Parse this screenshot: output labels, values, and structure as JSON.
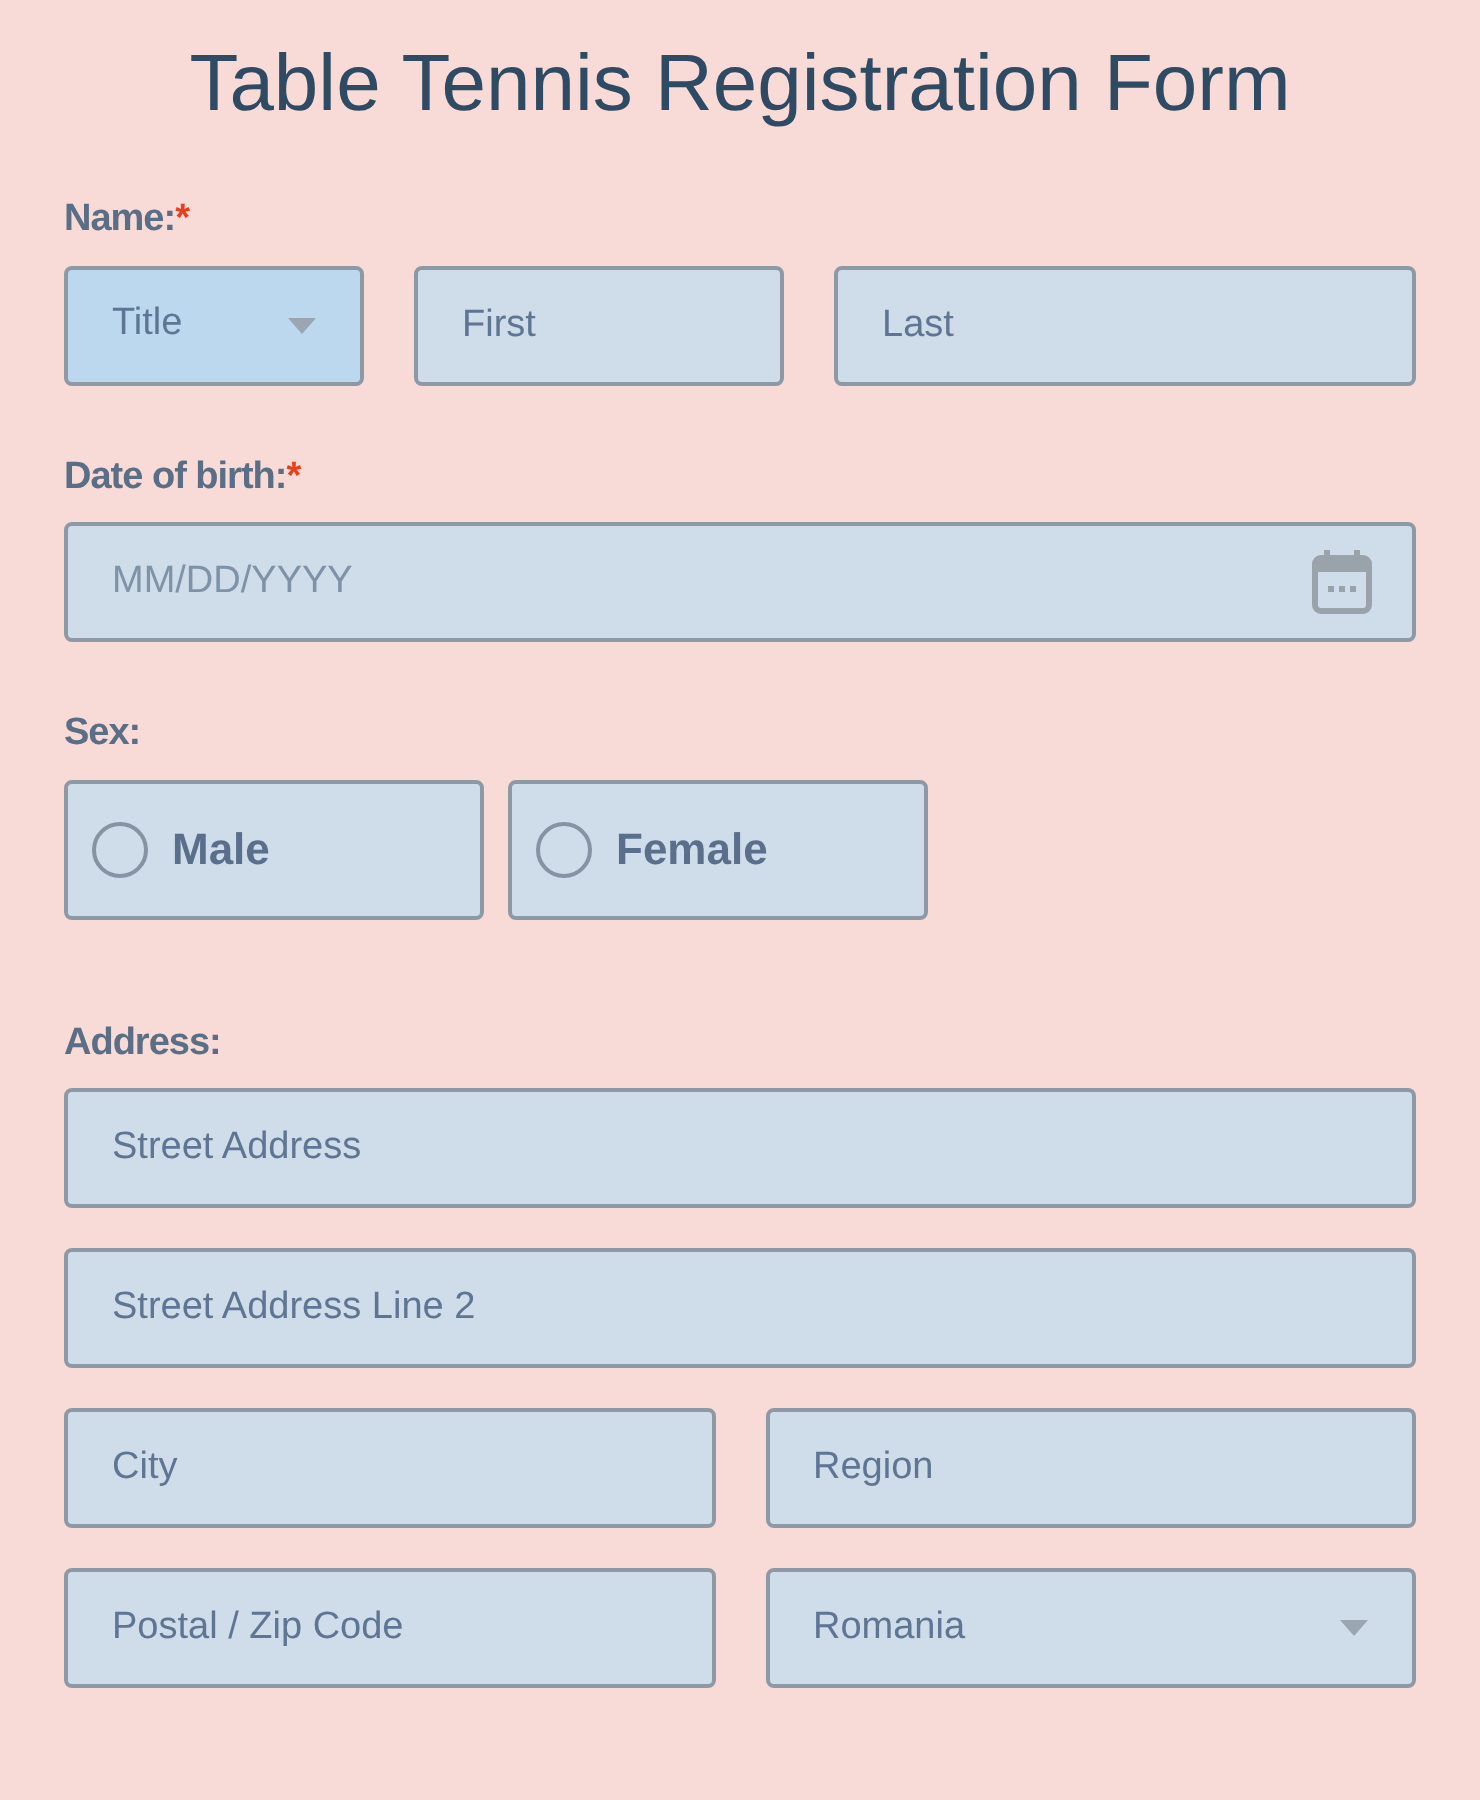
{
  "title": "Table Tennis Registration Form",
  "sections": [
    {
      "kind": "name",
      "label": "Name:",
      "required_mark": "*",
      "fields": [
        {
          "kind": "select",
          "text": "Title",
          "highlighted": true
        },
        {
          "kind": "text",
          "placeholder": "First"
        },
        {
          "kind": "text",
          "placeholder": "Last"
        }
      ]
    },
    {
      "kind": "date",
      "label": "Date of birth:",
      "required_mark": "*",
      "placeholder": "MM/DD/YYYY"
    },
    {
      "kind": "radio",
      "label": "Sex:",
      "options": [
        {
          "label": "Male",
          "checked": false
        },
        {
          "label": "Female",
          "checked": false
        }
      ]
    },
    {
      "kind": "address",
      "label": "Address:",
      "rows": [
        [
          {
            "kind": "text",
            "placeholder": "Street Address"
          }
        ],
        [
          {
            "kind": "text",
            "placeholder": "Street Address Line 2"
          }
        ],
        [
          {
            "kind": "text",
            "placeholder": "City"
          },
          {
            "kind": "text",
            "placeholder": "Region"
          }
        ],
        [
          {
            "kind": "text",
            "placeholder": "Postal / Zip Code"
          },
          {
            "kind": "select",
            "text": "Romania",
            "highlighted": false
          }
        ]
      ]
    }
  ]
}
